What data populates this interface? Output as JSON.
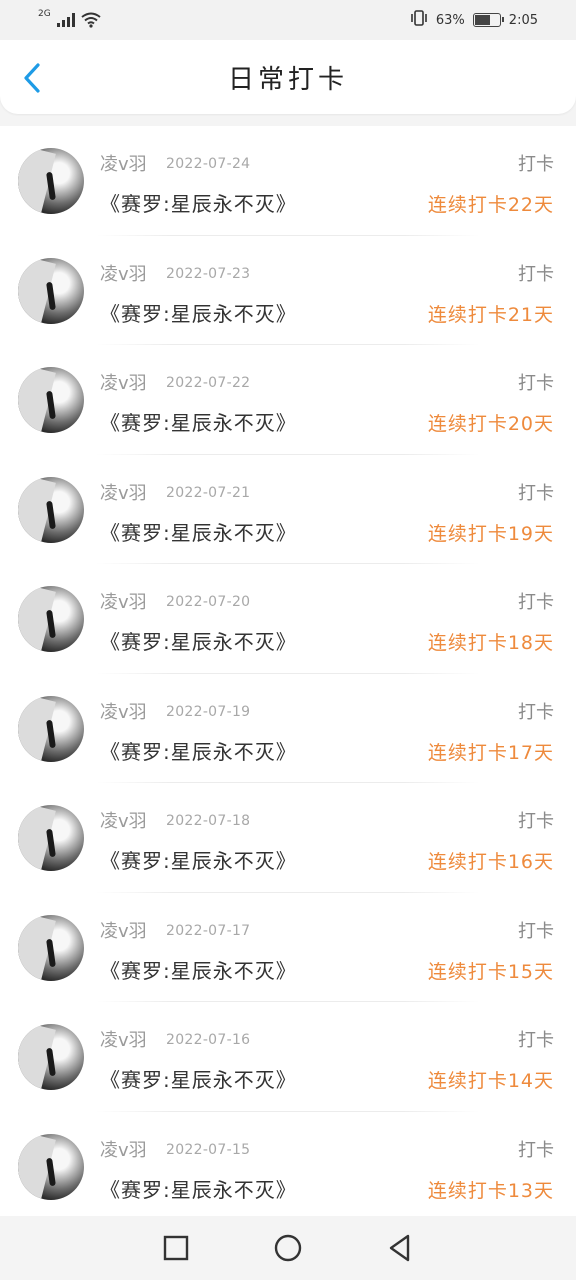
{
  "status_bar": {
    "network": "2G",
    "battery_percent": "63%",
    "time": "2:05"
  },
  "header": {
    "title": "日常打卡"
  },
  "checkins": [
    {
      "user": "凌v羽",
      "date": "2022-07-24",
      "type": "打卡",
      "book": "《赛罗:星辰永不灭》",
      "streak": "连续打卡22天"
    },
    {
      "user": "凌v羽",
      "date": "2022-07-23",
      "type": "打卡",
      "book": "《赛罗:星辰永不灭》",
      "streak": "连续打卡21天"
    },
    {
      "user": "凌v羽",
      "date": "2022-07-22",
      "type": "打卡",
      "book": "《赛罗:星辰永不灭》",
      "streak": "连续打卡20天"
    },
    {
      "user": "凌v羽",
      "date": "2022-07-21",
      "type": "打卡",
      "book": "《赛罗:星辰永不灭》",
      "streak": "连续打卡19天"
    },
    {
      "user": "凌v羽",
      "date": "2022-07-20",
      "type": "打卡",
      "book": "《赛罗:星辰永不灭》",
      "streak": "连续打卡18天"
    },
    {
      "user": "凌v羽",
      "date": "2022-07-19",
      "type": "打卡",
      "book": "《赛罗:星辰永不灭》",
      "streak": "连续打卡17天"
    },
    {
      "user": "凌v羽",
      "date": "2022-07-18",
      "type": "打卡",
      "book": "《赛罗:星辰永不灭》",
      "streak": "连续打卡16天"
    },
    {
      "user": "凌v羽",
      "date": "2022-07-17",
      "type": "打卡",
      "book": "《赛罗:星辰永不灭》",
      "streak": "连续打卡15天"
    },
    {
      "user": "凌v羽",
      "date": "2022-07-16",
      "type": "打卡",
      "book": "《赛罗:星辰永不灭》",
      "streak": "连续打卡14天"
    },
    {
      "user": "凌v羽",
      "date": "2022-07-15",
      "type": "打卡",
      "book": "《赛罗:星辰永不灭》",
      "streak": "连续打卡13天"
    }
  ],
  "colors": {
    "accent_back": "#1e9be6",
    "streak": "#ee8a3c"
  },
  "icons": {
    "back": "chevron-left-icon",
    "nav_recent": "square-icon",
    "nav_home": "circle-icon",
    "nav_back": "triangle-back-icon"
  }
}
